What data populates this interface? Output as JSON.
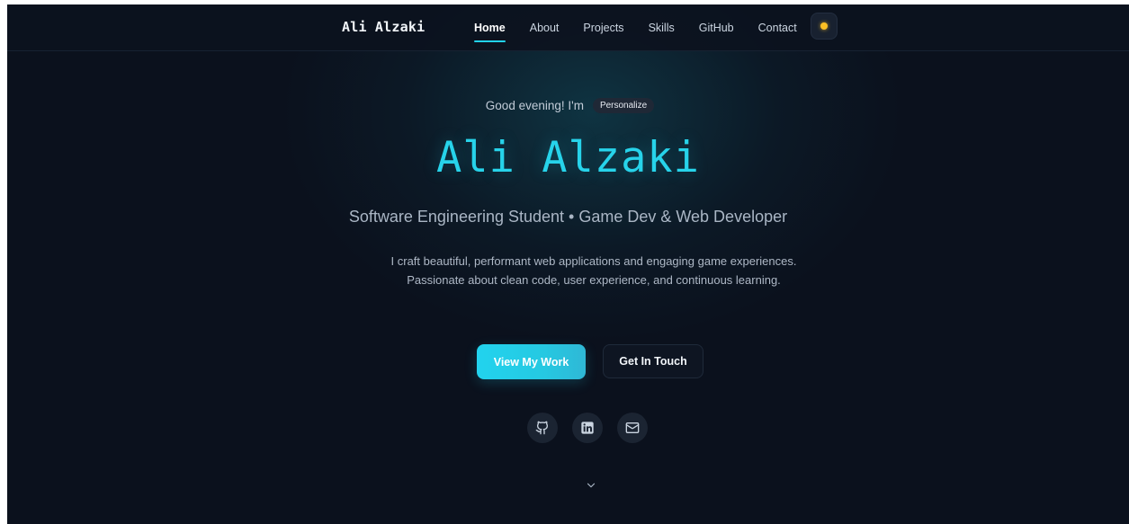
{
  "nav": {
    "brand": "Ali Alzaki",
    "links": [
      {
        "label": "Home",
        "active": true
      },
      {
        "label": "About",
        "active": false
      },
      {
        "label": "Projects",
        "active": false
      },
      {
        "label": "Skills",
        "active": false
      },
      {
        "label": "GitHub",
        "active": false
      },
      {
        "label": "Contact",
        "active": false
      }
    ],
    "theme_toggle_icon": "sun-icon"
  },
  "hero": {
    "greeting": "Good evening! I'm",
    "personalize_label": "Personalize",
    "name": "Ali Alzaki",
    "subtitle": "Software Engineering Student • Game Dev & Web Developer",
    "description": "I craft beautiful, performant web applications and engaging game experiences. Passionate about clean code, user experience, and continuous learning.",
    "primary_button": "View My Work",
    "secondary_button": "Get In Touch",
    "socials": [
      {
        "icon": "github-icon"
      },
      {
        "icon": "linkedin-icon"
      },
      {
        "icon": "mail-icon"
      }
    ],
    "scroll_icon": "chevron-down-icon"
  },
  "colors": {
    "background": "#0b111d",
    "accent": "#22d3ee",
    "theme_toggle_dot": "#fbbf24"
  }
}
